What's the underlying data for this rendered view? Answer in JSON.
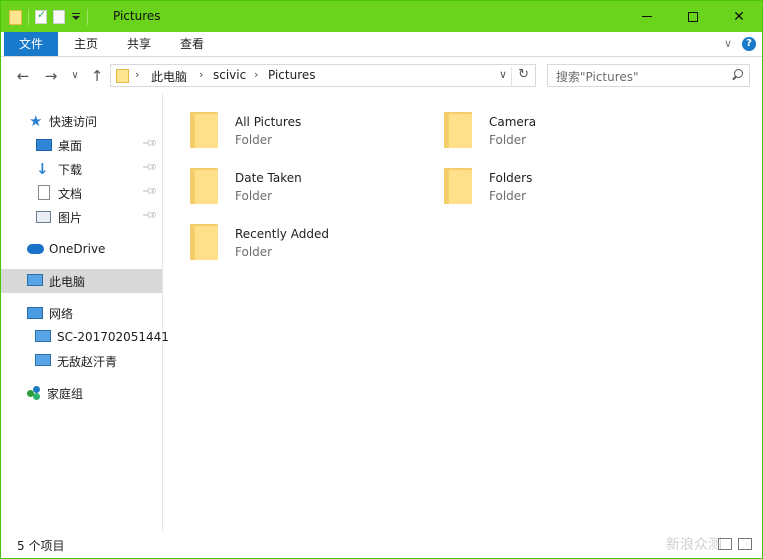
{
  "window": {
    "title": "Pictures"
  },
  "ribbon": {
    "tabs": [
      "文件",
      "主页",
      "共享",
      "查看"
    ]
  },
  "nav_buttons": {
    "back": "←",
    "forward": "→",
    "recent": "∨",
    "up": "↑"
  },
  "address": {
    "crumbs": [
      "此电脑",
      "scivic",
      "Pictures"
    ],
    "refresh": "↻"
  },
  "search": {
    "placeholder": "搜索\"Pictures\""
  },
  "navpane": {
    "quick_access": "快速访问",
    "items": [
      {
        "label": "桌面",
        "icon": "desktop-icon"
      },
      {
        "label": "下载",
        "icon": "download-icon"
      },
      {
        "label": "文档",
        "icon": "documents-icon"
      },
      {
        "label": "图片",
        "icon": "pictures-icon"
      }
    ],
    "onedrive": "OneDrive",
    "this_pc": "此电脑",
    "network": "网络",
    "network_items": [
      "SC-201702051441",
      "无敌赵汗青"
    ],
    "homegroup": "家庭组"
  },
  "folders": [
    {
      "name": "All Pictures",
      "type": "Folder"
    },
    {
      "name": "Camera",
      "type": "Folder"
    },
    {
      "name": "Date Taken",
      "type": "Folder"
    },
    {
      "name": "Folders",
      "type": "Folder"
    },
    {
      "name": "Recently Added",
      "type": "Folder"
    }
  ],
  "status": {
    "count_text": "5 个项目"
  },
  "watermark": "新浪众测",
  "colors": {
    "titlebar": "#6ad31c",
    "file_tab": "#1979ca",
    "selected_nav": "#d9d9d9"
  }
}
